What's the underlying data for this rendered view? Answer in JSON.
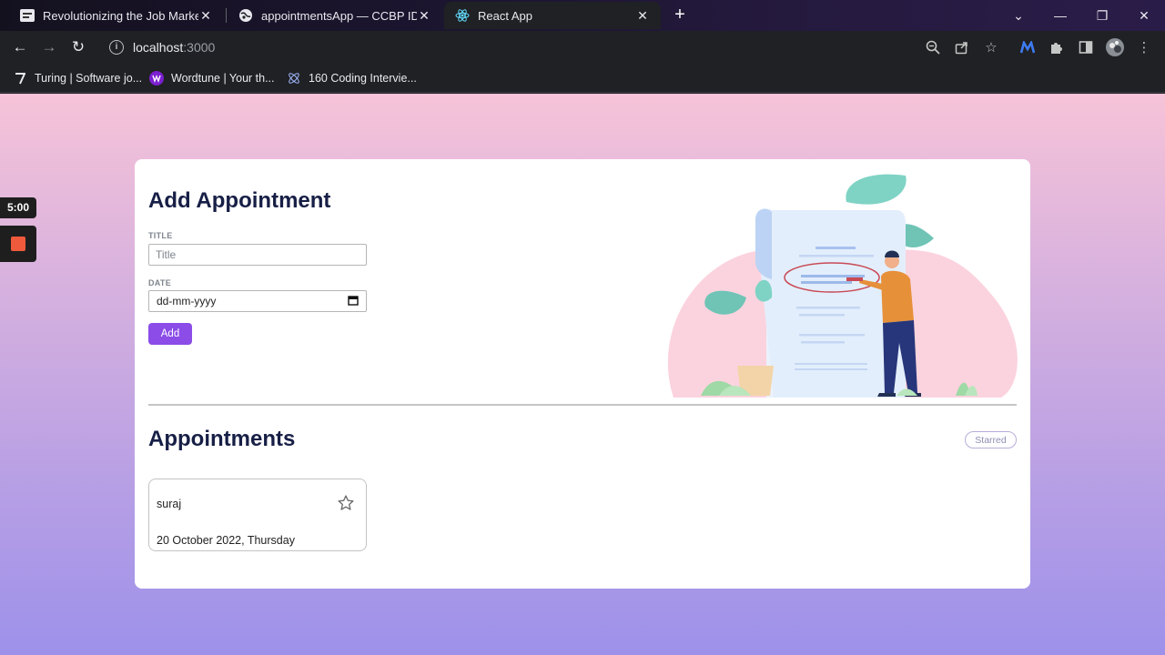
{
  "browser": {
    "tabs": [
      {
        "title": "Revolutionizing the Job Market |",
        "icon": "news-favicon",
        "active": false
      },
      {
        "title": "appointmentsApp — CCBP IDE",
        "icon": "globe-icon",
        "active": false
      },
      {
        "title": "React App",
        "icon": "react-icon",
        "active": true
      }
    ],
    "address": {
      "host": "localhost",
      "port": ":3000"
    },
    "bookmarks": [
      {
        "label": "Turing | Software jo...",
        "icon": "turing-icon"
      },
      {
        "label": "Wordtune | Your th...",
        "icon": "wordtune-icon"
      },
      {
        "label": "160 Coding Intervie...",
        "icon": "coding-icon"
      }
    ]
  },
  "recorder": {
    "timer": "5:00"
  },
  "form": {
    "heading": "Add Appointment",
    "title_label": "TITLE",
    "title_placeholder": "Title",
    "date_label": "DATE",
    "date_placeholder": "dd-mm-yyyy",
    "add_label": "Add"
  },
  "appointments": {
    "heading": "Appointments",
    "starred_label": "Starred",
    "items": [
      {
        "title": "suraj",
        "date": "20 October 2022, Thursday",
        "starred": false
      }
    ]
  },
  "colors": {
    "accent": "#8b4ce8",
    "heading": "#171f46",
    "bg_top": "#f6c3d8",
    "bg_bottom": "#9d91ea"
  }
}
